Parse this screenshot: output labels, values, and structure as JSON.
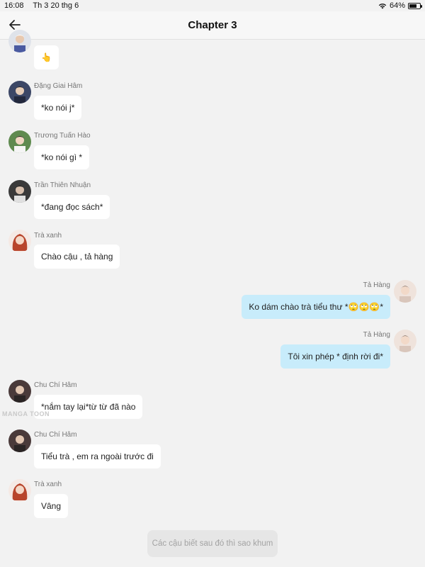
{
  "status": {
    "time": "16:08",
    "date": "Th 3 20 thg 6",
    "battery": "64%",
    "battery_level": 0.64
  },
  "nav": {
    "title": "Chapter 3"
  },
  "watermark": "MANGA TOON",
  "messages": [
    {
      "sender": "",
      "text": "👆",
      "side": "left",
      "avatar": "avatar-boy-white"
    },
    {
      "sender": "Đặng Giai Hâm",
      "text": "*ko nói j*",
      "side": "left",
      "avatar": "avatar-boy-dark"
    },
    {
      "sender": "Trương Tuấn Hào",
      "text": "*ko nói gì *",
      "side": "left",
      "avatar": "avatar-boy-green"
    },
    {
      "sender": "Trần Thiên Nhuận",
      "text": "*đang đọc sách*",
      "side": "left",
      "avatar": "avatar-boy-dark2"
    },
    {
      "sender": "Trà xanh",
      "text": "Chào cậu , tả hàng",
      "side": "left",
      "avatar": "avatar-girl-red"
    },
    {
      "sender": "Tả Hàng",
      "text": "Ko dám chào trà tiểu thư *🙄🙄🙄*",
      "side": "right",
      "avatar": "avatar-boy-light"
    },
    {
      "sender": "Tả Hàng",
      "text": "Tôi xin phép * định rời đi*",
      "side": "right",
      "avatar": "avatar-boy-light"
    },
    {
      "sender": "Chu Chí Hâm",
      "text": "*nắm tay lại*từ từ đã nào",
      "side": "left",
      "avatar": "avatar-boy-dark3"
    },
    {
      "sender": "Chu Chí Hâm",
      "text": "Tiểu trà , em ra ngoài trước đi",
      "side": "left",
      "avatar": "avatar-boy-dark3"
    },
    {
      "sender": "Trà xanh",
      "text": "Vâng",
      "side": "left",
      "avatar": "avatar-girl-red"
    }
  ],
  "footer": {
    "prompt": "Các cậu biết sau đó thì sao khum"
  }
}
